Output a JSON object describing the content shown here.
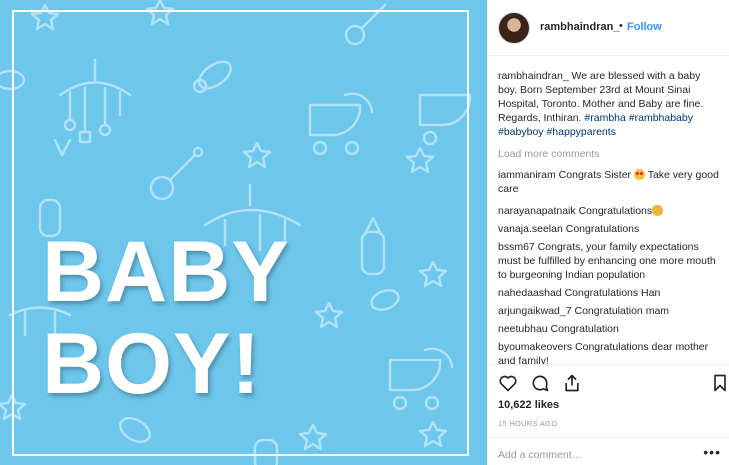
{
  "post": {
    "headline_line1": "BABY",
    "headline_line2": "BOY!",
    "bg_color": "#6dc6ec"
  },
  "header": {
    "username": "rambhaindran_",
    "separator": "•",
    "follow_label": "Follow"
  },
  "caption": {
    "username": "rambhaindran_",
    "text": " We are blessed with a baby boy. Born September 23rd at Mount Sinai Hospital, Toronto. Mother and Baby are fine. Regards, Inthiran. ",
    "hashtags": [
      "#rambha",
      "#rambhababy",
      "#babyboy",
      "#happyparents"
    ]
  },
  "load_more_label": "Load more comments",
  "comments": [
    {
      "user": "iammaniram",
      "text": " Congrats Sister ",
      "emoji": "heart-eyes-emoji",
      "text_after": " Take very good care"
    },
    {
      "user": "narayanapatnaik",
      "text": " Congratulations",
      "emoji": "clapping-hands-emoji",
      "text_after": ""
    },
    {
      "user": "vanaja.seelan",
      "text": " Congratulations",
      "emoji": "",
      "text_after": ""
    },
    {
      "user": "bssm67",
      "text": " Congrats, your family expectations must be fulfilled by enhancing one more mouth to burgeoning Indian population",
      "emoji": "",
      "text_after": ""
    },
    {
      "user": "nahedaashad",
      "text": " Congratulations Han",
      "emoji": "",
      "text_after": ""
    },
    {
      "user": "arjungaikwad_7",
      "text": " Congratulation mam",
      "emoji": "",
      "text_after": ""
    },
    {
      "user": "neetubhau",
      "text": " Congratulation",
      "emoji": "",
      "text_after": ""
    },
    {
      "user": "byoumakeovers",
      "text": " Congratulations dear mother and family!",
      "emoji": "",
      "text_after": ""
    }
  ],
  "actions": {
    "icons": [
      "heart-icon",
      "comment-icon",
      "share-icon",
      "bookmark-icon"
    ]
  },
  "likes_label": "10,622 likes",
  "timestamp": "15 HOURS AGO",
  "add_comment_placeholder": "Add a comment…",
  "more_label": "•••"
}
